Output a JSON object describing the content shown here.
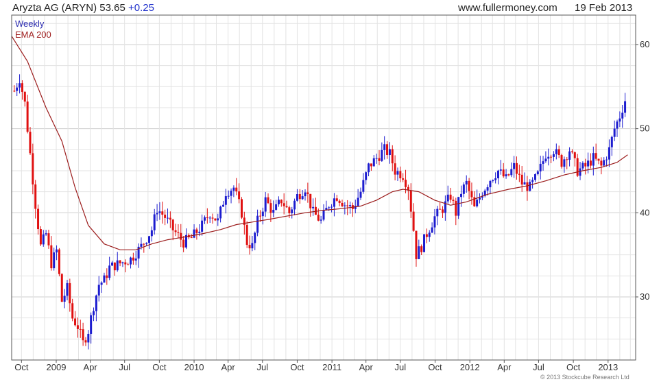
{
  "header": {
    "name": "Aryzta AG (ARYN)",
    "price": "53.65",
    "change": "+0.25",
    "site": "www.fullermoney.com",
    "date": "19 Feb 2013"
  },
  "legend": {
    "period": "Weekly",
    "ma": "EMA 200"
  },
  "copyright": "© 2013 Stockcube Research Ltd",
  "colors": {
    "up": "#1c1ccf",
    "down": "#e01010",
    "ema": "#9b1b1b",
    "grid": "#e3e3e3",
    "gridMajor": "#cfcfcf",
    "frame": "#555555"
  },
  "chart_data": {
    "type": "line",
    "title": "",
    "xlabel": "",
    "ylabel": "",
    "x_ticks": [
      "Oct",
      "2009",
      "Apr",
      "Jul",
      "Oct",
      "2010",
      "Apr",
      "Jul",
      "Oct",
      "2011",
      "Apr",
      "Jul",
      "Oct",
      "2012",
      "Apr",
      "Jul",
      "Oct",
      "2013"
    ],
    "y_ticks": [
      30,
      40,
      50,
      60
    ],
    "ylim": [
      22.5,
      63.5
    ],
    "y_axis_side": "right",
    "grid": true,
    "legend_position": "top-left",
    "x_range": [
      "2008-09-05",
      "2013-03-15"
    ],
    "series": [
      {
        "name": "Weekly",
        "kind": "price",
        "key_points": [
          [
            "2008-09-12",
            54.5
          ],
          [
            "2008-09-26",
            56.0
          ],
          [
            "2008-10-10",
            53.0
          ],
          [
            "2008-10-24",
            47.0
          ],
          [
            "2008-11-07",
            41.0
          ],
          [
            "2008-11-21",
            36.0
          ],
          [
            "2008-12-05",
            37.5
          ],
          [
            "2008-12-19",
            34.0
          ],
          [
            "2009-01-02",
            35.5
          ],
          [
            "2009-01-16",
            29.5
          ],
          [
            "2009-01-30",
            31.0
          ],
          [
            "2009-02-13",
            27.5
          ],
          [
            "2009-02-27",
            26.5
          ],
          [
            "2009-03-13",
            24.5
          ],
          [
            "2009-03-27",
            26.0
          ],
          [
            "2009-04-10",
            29.0
          ],
          [
            "2009-04-24",
            31.5
          ],
          [
            "2009-05-08",
            32.0
          ],
          [
            "2009-05-22",
            33.5
          ],
          [
            "2009-06-19",
            34.0
          ],
          [
            "2009-07-17",
            34.5
          ],
          [
            "2009-08-14",
            36.0
          ],
          [
            "2009-09-11",
            38.0
          ],
          [
            "2009-09-25",
            40.5
          ],
          [
            "2009-10-16",
            39.5
          ],
          [
            "2009-11-06",
            38.0
          ],
          [
            "2009-12-04",
            36.5
          ],
          [
            "2009-12-25",
            37.0
          ],
          [
            "2010-01-22",
            38.5
          ],
          [
            "2010-02-12",
            40.0
          ],
          [
            "2010-03-05",
            39.0
          ],
          [
            "2010-03-26",
            42.5
          ],
          [
            "2010-04-16",
            43.0
          ],
          [
            "2010-05-07",
            40.0
          ],
          [
            "2010-05-21",
            36.5
          ],
          [
            "2010-06-04",
            36.0
          ],
          [
            "2010-06-18",
            39.0
          ],
          [
            "2010-07-09",
            41.5
          ],
          [
            "2010-07-30",
            40.0
          ],
          [
            "2010-08-20",
            41.5
          ],
          [
            "2010-09-10",
            40.0
          ],
          [
            "2010-10-01",
            42.0
          ],
          [
            "2010-10-22",
            43.0
          ],
          [
            "2010-11-12",
            40.0
          ],
          [
            "2010-12-03",
            39.0
          ],
          [
            "2010-12-24",
            41.0
          ],
          [
            "2011-01-14",
            42.0
          ],
          [
            "2011-02-04",
            41.0
          ],
          [
            "2011-02-25",
            40.5
          ],
          [
            "2011-03-18",
            42.5
          ],
          [
            "2011-04-08",
            45.5
          ],
          [
            "2011-04-29",
            46.5
          ],
          [
            "2011-05-20",
            47.5
          ],
          [
            "2011-06-03",
            47.0
          ],
          [
            "2011-06-17",
            45.0
          ],
          [
            "2011-07-08",
            44.5
          ],
          [
            "2011-07-22",
            43.0
          ],
          [
            "2011-08-05",
            38.0
          ],
          [
            "2011-08-12",
            35.0
          ],
          [
            "2011-08-26",
            36.0
          ],
          [
            "2011-09-09",
            37.5
          ],
          [
            "2011-09-30",
            39.5
          ],
          [
            "2011-10-21",
            40.5
          ],
          [
            "2011-11-11",
            42.0
          ],
          [
            "2011-11-25",
            40.0
          ],
          [
            "2011-12-09",
            42.5
          ],
          [
            "2011-12-23",
            43.5
          ],
          [
            "2012-01-13",
            40.5
          ],
          [
            "2012-02-03",
            42.5
          ],
          [
            "2012-02-24",
            44.0
          ],
          [
            "2012-03-16",
            45.0
          ],
          [
            "2012-04-06",
            44.0
          ],
          [
            "2012-04-27",
            45.5
          ],
          [
            "2012-05-18",
            43.5
          ],
          [
            "2012-06-08",
            43.0
          ],
          [
            "2012-06-29",
            44.5
          ],
          [
            "2012-07-20",
            47.0
          ],
          [
            "2012-08-10",
            47.5
          ],
          [
            "2012-08-31",
            46.0
          ],
          [
            "2012-09-21",
            47.5
          ],
          [
            "2012-10-12",
            45.0
          ],
          [
            "2012-11-02",
            45.5
          ],
          [
            "2012-11-23",
            46.5
          ],
          [
            "2012-12-14",
            45.5
          ],
          [
            "2013-01-04",
            47.5
          ],
          [
            "2013-01-18",
            50.0
          ],
          [
            "2013-02-01",
            51.5
          ],
          [
            "2013-02-15",
            53.4
          ]
        ]
      },
      {
        "name": "EMA 200",
        "kind": "ema",
        "key_points": [
          [
            "2008-09-05",
            61.0
          ],
          [
            "2008-10-17",
            58.0
          ],
          [
            "2008-12-05",
            52.5
          ],
          [
            "2009-01-16",
            48.5
          ],
          [
            "2009-02-20",
            43.0
          ],
          [
            "2009-03-27",
            38.5
          ],
          [
            "2009-05-08",
            36.3
          ],
          [
            "2009-06-19",
            35.6
          ],
          [
            "2009-07-31",
            35.6
          ],
          [
            "2009-09-11",
            36.3
          ],
          [
            "2009-10-23",
            36.8
          ],
          [
            "2009-12-04",
            37.1
          ],
          [
            "2010-01-22",
            37.5
          ],
          [
            "2010-03-12",
            38.0
          ],
          [
            "2010-04-23",
            38.6
          ],
          [
            "2010-06-04",
            38.9
          ],
          [
            "2010-07-16",
            39.2
          ],
          [
            "2010-09-03",
            39.6
          ],
          [
            "2010-10-22",
            40.0
          ],
          [
            "2010-12-10",
            40.3
          ],
          [
            "2011-01-28",
            40.5
          ],
          [
            "2011-03-18",
            40.8
          ],
          [
            "2011-04-29",
            41.5
          ],
          [
            "2011-06-10",
            42.5
          ],
          [
            "2011-07-08",
            42.8
          ],
          [
            "2011-08-19",
            42.5
          ],
          [
            "2011-09-30",
            41.5
          ],
          [
            "2011-11-11",
            40.9
          ],
          [
            "2011-12-23",
            41.3
          ],
          [
            "2012-02-17",
            42.2
          ],
          [
            "2012-04-13",
            42.8
          ],
          [
            "2012-06-01",
            43.2
          ],
          [
            "2012-07-20",
            43.8
          ],
          [
            "2012-09-07",
            44.5
          ],
          [
            "2012-10-26",
            45.0
          ],
          [
            "2012-12-14",
            45.4
          ],
          [
            "2013-01-25",
            46.0
          ],
          [
            "2013-02-22",
            46.9
          ]
        ]
      }
    ]
  }
}
